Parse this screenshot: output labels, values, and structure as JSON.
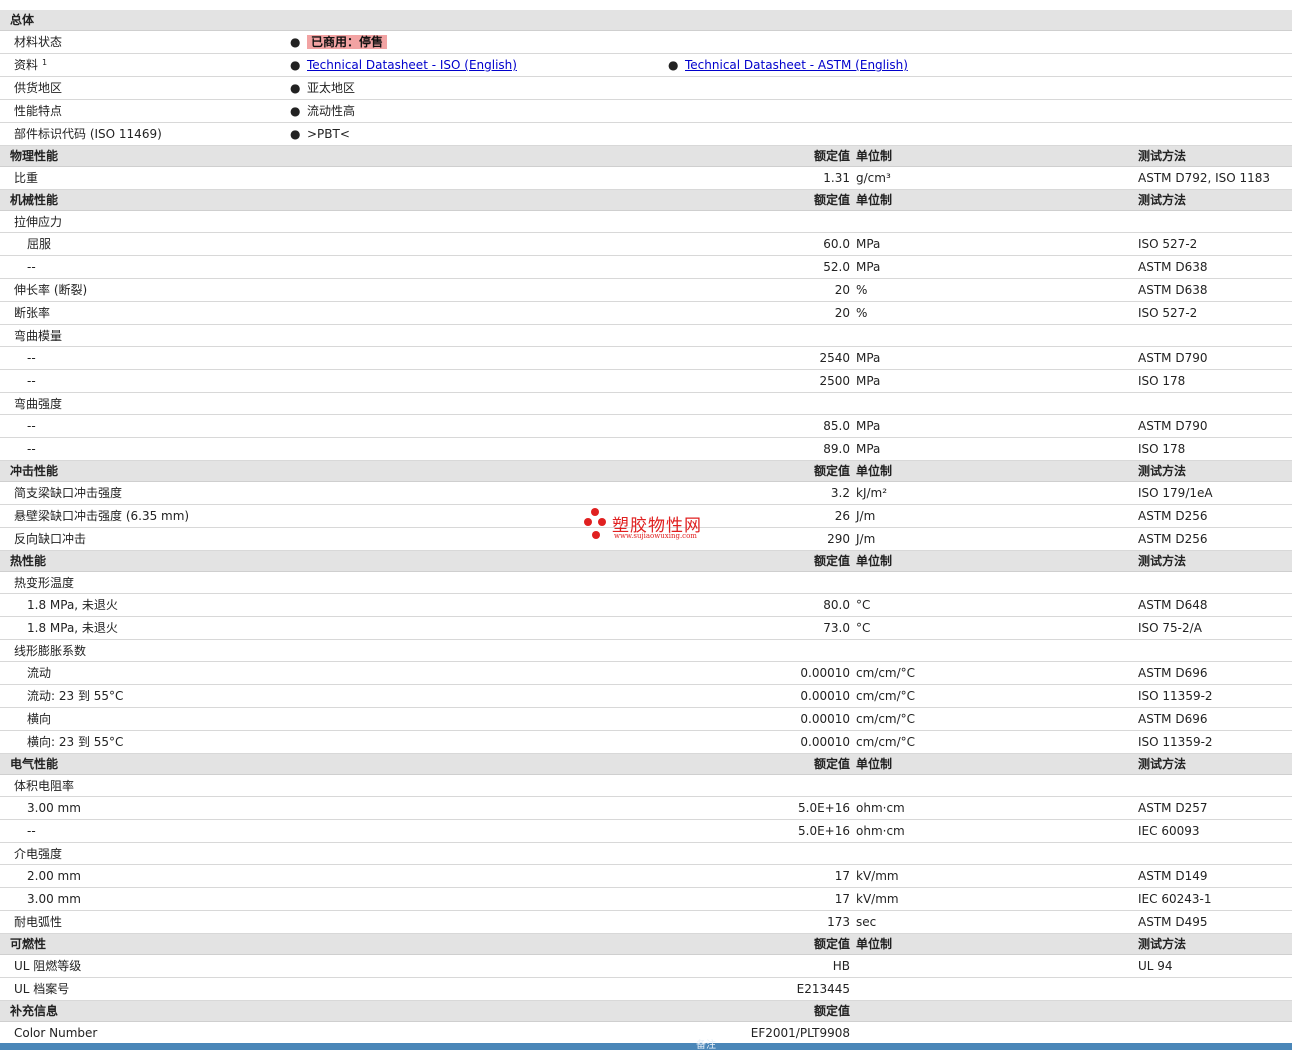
{
  "general": {
    "section_title": "总体",
    "status_label": "材料状态",
    "status_value": "已商用：停售",
    "docs_label": "资料",
    "docs_sup": "1",
    "doc1": "Technical Datasheet - ISO (English)",
    "doc2": "Technical Datasheet - ASTM (English)",
    "region_label": "供货地区",
    "region_value": "亚太地区",
    "feature_label": "性能特点",
    "feature_value": "流动性高",
    "marking_label": "部件标识代码 (ISO 11469)",
    "marking_value": ">PBT<",
    "bullet": "●"
  },
  "col_headers": {
    "nominal": "额定值",
    "unit": "单位制",
    "test": "测试方法"
  },
  "sections": [
    {
      "title": "物理性能",
      "rows": [
        {
          "name": "比重",
          "value": "1.31",
          "unit": "g/cm³",
          "test": "ASTM D792, ISO 1183"
        }
      ]
    },
    {
      "title": "机械性能",
      "rows": [
        {
          "name": "拉伸应力",
          "group": true
        },
        {
          "name": "屈服",
          "indent": true,
          "value": "60.0",
          "unit": "MPa",
          "test": "ISO 527-2"
        },
        {
          "name": "--",
          "indent": true,
          "value": "52.0",
          "unit": "MPa",
          "test": "ASTM D638"
        },
        {
          "name": "伸长率 (断裂)",
          "value": "20",
          "unit": "%",
          "test": "ASTM D638"
        },
        {
          "name": "断张率",
          "value": "20",
          "unit": "%",
          "test": "ISO 527-2"
        },
        {
          "name": "弯曲模量",
          "group": true
        },
        {
          "name": "--",
          "indent": true,
          "value": "2540",
          "unit": "MPa",
          "test": "ASTM D790"
        },
        {
          "name": "--",
          "indent": true,
          "value": "2500",
          "unit": "MPa",
          "test": "ISO 178"
        },
        {
          "name": "弯曲强度",
          "group": true
        },
        {
          "name": "--",
          "indent": true,
          "value": "85.0",
          "unit": "MPa",
          "test": "ASTM D790"
        },
        {
          "name": "--",
          "indent": true,
          "value": "89.0",
          "unit": "MPa",
          "test": "ISO 178"
        }
      ]
    },
    {
      "title": "冲击性能",
      "rows": [
        {
          "name": "简支梁缺口冲击强度",
          "value": "3.2",
          "unit": "kJ/m²",
          "test": "ISO 179/1eA"
        },
        {
          "name": "悬壁梁缺口冲击强度 (6.35 mm)",
          "value": "26",
          "unit": "J/m",
          "test": "ASTM D256"
        },
        {
          "name": "反向缺口冲击",
          "value": "290",
          "unit": "J/m",
          "test": "ASTM D256"
        }
      ]
    },
    {
      "title": "热性能",
      "rows": [
        {
          "name": "热变形温度",
          "group": true
        },
        {
          "name": "1.8 MPa, 未退火",
          "indent": true,
          "value": "80.0",
          "unit": "°C",
          "test": "ASTM D648"
        },
        {
          "name": "1.8 MPa, 未退火",
          "indent": true,
          "value": "73.0",
          "unit": "°C",
          "test": "ISO 75-2/A"
        },
        {
          "name": "线形膨胀系数",
          "group": true
        },
        {
          "name": "流动",
          "indent": true,
          "value": "0.00010",
          "unit": "cm/cm/°C",
          "test": "ASTM D696"
        },
        {
          "name": "流动: 23 到 55°C",
          "indent": true,
          "value": "0.00010",
          "unit": "cm/cm/°C",
          "test": "ISO 11359-2"
        },
        {
          "name": "横向",
          "indent": true,
          "value": "0.00010",
          "unit": "cm/cm/°C",
          "test": "ASTM D696"
        },
        {
          "name": "横向: 23 到 55°C",
          "indent": true,
          "value": "0.00010",
          "unit": "cm/cm/°C",
          "test": "ISO 11359-2"
        }
      ]
    },
    {
      "title": "电气性能",
      "rows": [
        {
          "name": "体积电阻率",
          "group": true
        },
        {
          "name": "3.00 mm",
          "indent": true,
          "value": "5.0E+16",
          "unit": "ohm·cm",
          "test": "ASTM D257"
        },
        {
          "name": "--",
          "indent": true,
          "value": "5.0E+16",
          "unit": "ohm·cm",
          "test": "IEC 60093"
        },
        {
          "name": "介电强度",
          "group": true
        },
        {
          "name": "2.00 mm",
          "indent": true,
          "value": "17",
          "unit": "kV/mm",
          "test": "ASTM D149"
        },
        {
          "name": "3.00 mm",
          "indent": true,
          "value": "17",
          "unit": "kV/mm",
          "test": "IEC 60243-1"
        },
        {
          "name": "耐电弧性",
          "value": "173",
          "unit": "sec",
          "test": "ASTM D495"
        }
      ]
    },
    {
      "title": "可燃性",
      "rows": [
        {
          "name": "UL 阻燃等级",
          "value": "HB",
          "unit": "",
          "test": "UL 94"
        },
        {
          "name": "UL 档案号",
          "value": "E213445",
          "unit": "",
          "test": ""
        }
      ]
    },
    {
      "title": "补充信息",
      "nominal_only": true,
      "rows": [
        {
          "name": "Color Number",
          "value": "EF2001/PLT9908",
          "unit": "",
          "test": ""
        }
      ]
    }
  ],
  "footer_label": "备注",
  "watermark": {
    "name": "塑胶物性网",
    "url": "www.sujiaowuxing.com"
  }
}
